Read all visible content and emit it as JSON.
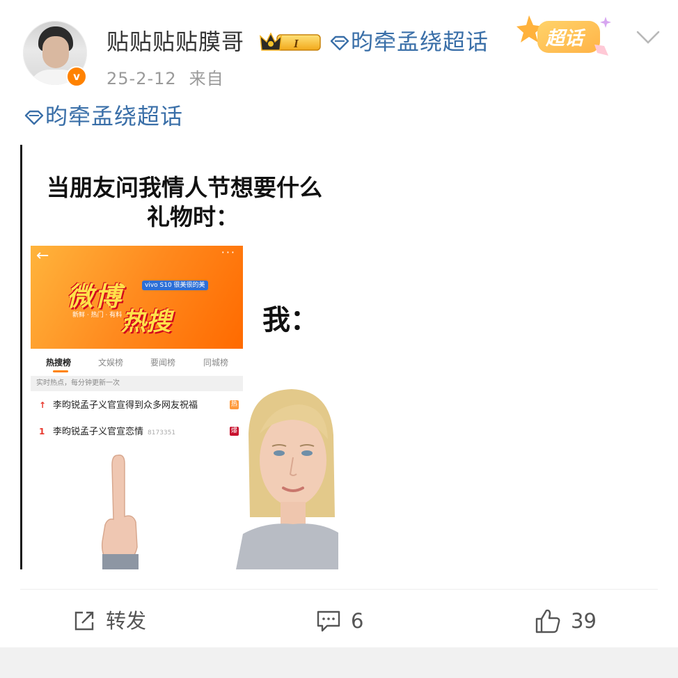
{
  "post": {
    "username": "贴贴贴贴膜哥",
    "member_badge_letter": "I",
    "header_topic": "昀牵孟绕超话",
    "chaohua_badge": "超话",
    "date": "25-2-12",
    "source_prefix": "来自",
    "body_topic": "昀牵孟绕超话"
  },
  "meme": {
    "caption_line1": "当朋友问我情人节想要什么",
    "caption_line2": "礼物时：",
    "me_label": "我：",
    "banner_title": "微博",
    "banner_title2": "热搜",
    "banner_sponsor": "vivo S10 很美很的美",
    "banner_sub": "新鲜 · 热门 · 有料",
    "tabs": [
      "热搜榜",
      "文娱榜",
      "要闻榜",
      "同城榜"
    ],
    "notice": "实时热点，每分钟更新一次",
    "hot_rows": [
      {
        "rank": "↑",
        "text": "李昀锐孟子义官宣得到众多网友祝福",
        "count": "",
        "tag": "热"
      },
      {
        "rank": "1",
        "text": "李昀锐孟子义官宣恋情",
        "count": "8173351",
        "tag": "爆"
      }
    ]
  },
  "actions": {
    "repost_label": "转发",
    "comment_count": "6",
    "like_count": "39"
  },
  "colors": {
    "link": "#3a6fa8",
    "verified": "#ff8200",
    "text": "#333333",
    "meta": "#9a9a9a"
  }
}
